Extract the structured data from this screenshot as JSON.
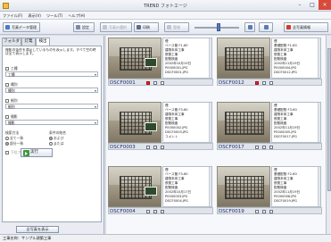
{
  "window": {
    "title": "TREND フォトエージ"
  },
  "menu": [
    "ファイル(F)",
    "表示(V)",
    "ツール(T)",
    "ヘルプ(H)"
  ],
  "toolbar": {
    "photo_album_edit": "写真データ管理",
    "settings": "設定",
    "select_disabled": "写真の選択",
    "print": "印刷",
    "register": "登録",
    "all_photo_info": "全写真情報",
    "zoom_level": 0.6
  },
  "left_panel": {
    "tabs": [
      "フォルダ",
      "灯篭",
      "検出"
    ],
    "hint": "撮影の条件を満足しているものを表示します。すべて空の時は全て表示します。",
    "conditions": [
      {
        "label": "工種",
        "checked": false,
        "value": "工種"
      },
      {
        "label": "種別",
        "checked": false,
        "value": "種別"
      },
      {
        "label": "細別",
        "checked": false,
        "value": "細別"
      },
      {
        "label": "撮影",
        "checked": false,
        "value": "撮影"
      }
    ],
    "match_mode": {
      "label1": "検索方法",
      "opt_all": "全て一致",
      "opt_part": "部分一致",
      "label2": "条件の結合",
      "opt_and": "および",
      "opt_or": "または",
      "include_subfolder": "下位フォルダも含める"
    },
    "run_label": "実行",
    "show_all_label": "全写真を表示"
  },
  "photos": [
    {
      "name": "DSCF0001",
      "lines": [
        "煙",
        "ベース管 F1-60",
        "建物本体工事",
        "鉄筋工事",
        "配筋検査",
        "2002年10月19日",
        "P0000001.JPG",
        "DSCF0001.JPG",
        "コメント"
      ]
    },
    {
      "name": "DSCF0012",
      "lines": [
        "煙",
        "基礎配筋 F1-60",
        "建物本体工事",
        "鉄筋工事",
        "配筋検査",
        "2002年11月19日",
        "P0000004.JPG",
        "DSCF0012.JPG",
        "コメント"
      ]
    },
    {
      "name": "DSCF0003",
      "lines": [
        "煙",
        "ベース管 F3-60",
        "建物本体工事",
        "鉄筋工事",
        "配筋検査",
        "P0000002.JPG",
        "DSCF0003.JPG",
        "コメント"
      ]
    },
    {
      "name": "DSCF0017",
      "lines": [
        "煙",
        "基礎配筋 F3-60",
        "建物本体工事",
        "鉄筋工事",
        "配筋検査",
        "2002年11月19日",
        "P0000005.JPG",
        "DSCF0017.JPG",
        "コメント"
      ]
    },
    {
      "name": "DSCF0004",
      "lines": [
        "煙",
        "ベース管 F3-60",
        "建物本体工事",
        "鉄筋工事",
        "配筋検査",
        "2002年10月17日",
        "P0000003.JPG",
        "DSCF0004.JPG",
        "コメント"
      ]
    },
    {
      "name": "DSCF0019",
      "lines": [
        "煙",
        "基礎配筋 F2-60",
        "建物本体工事",
        "鉄筋工事",
        "配筋検査",
        "2002年11月19日",
        "P0000006.JPG",
        "DSCF0019.JPG",
        "コメント"
      ]
    }
  ],
  "status": {
    "text": "工事名称：サンプル建築工事"
  },
  "colors": {
    "accent": "#1b2f6e",
    "close": "#d84a3a",
    "run": "#3c9a3c"
  }
}
